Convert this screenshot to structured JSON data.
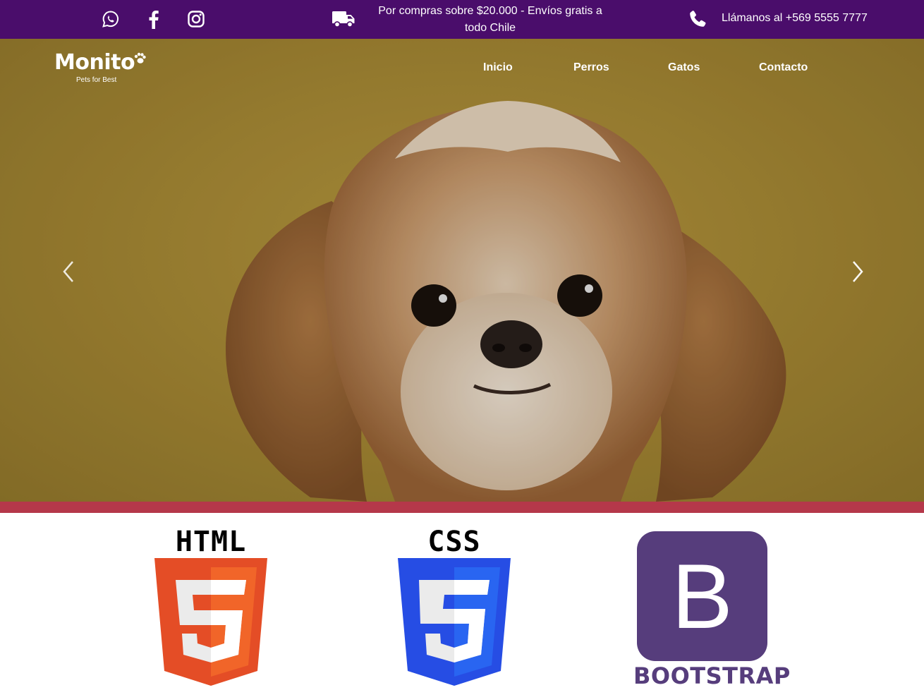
{
  "topbar": {
    "social_icons": [
      "whatsapp-icon",
      "facebook-icon",
      "instagram-icon"
    ],
    "promo_icon": "truck-icon",
    "promo_text": "Por compras sobre $20.000 - Envíos gratis a todo Chile",
    "phone_icon": "phone-icon",
    "phone_text": "Llámanos al +569 5555 7777",
    "background": "#4a0d6b"
  },
  "header": {
    "logo_title": "Monito",
    "logo_subtitle": "Pets for Best",
    "nav": [
      "Inicio",
      "Perros",
      "Gatos",
      "Contacto"
    ]
  },
  "hero": {
    "prev_icon": "chevron-left-icon",
    "next_icon": "chevron-right-icon",
    "background": "#a88a35"
  },
  "divider_color": "#b5384a",
  "tech": {
    "html_label": "HTML",
    "css_label": "CSS",
    "bootstrap_letter": "B",
    "bootstrap_label": "BOOTSTRAP",
    "html_color": "#e44d26",
    "css_color": "#264de4",
    "bootstrap_color": "#563d7c"
  }
}
